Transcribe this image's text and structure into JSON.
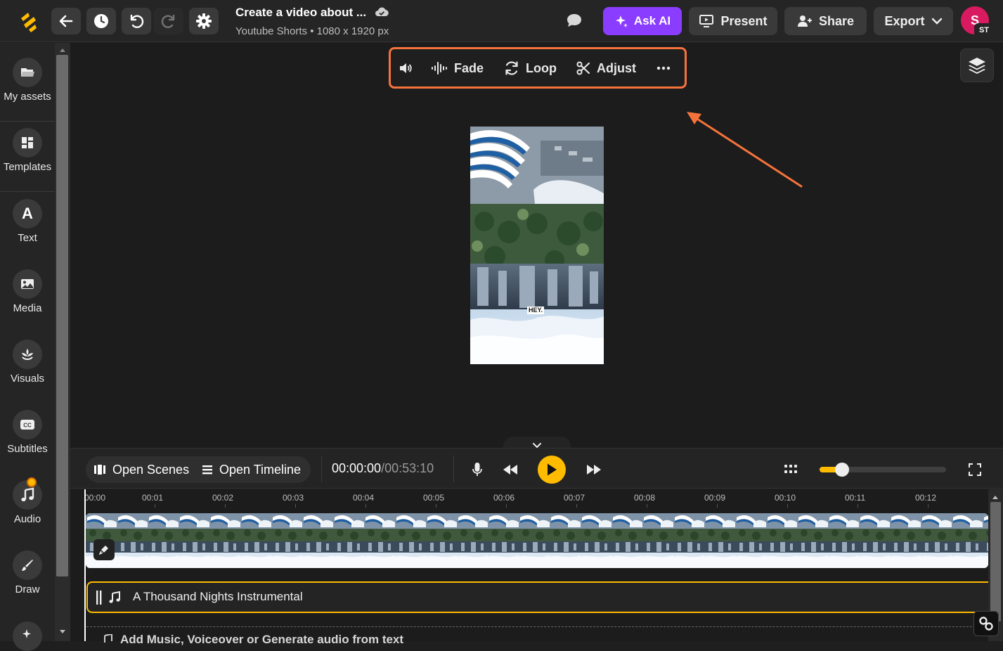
{
  "header": {
    "doc_title": "Create a video about ...",
    "doc_subtitle": "Youtube Shorts • 1080 x 1920 px",
    "ask_ai_label": "Ask AI",
    "present_label": "Present",
    "share_label": "Share",
    "export_label": "Export",
    "avatar_initial": "S",
    "avatar_badge": "ST"
  },
  "sidebar": {
    "items": [
      {
        "label": "My assets",
        "icon": "folder-icon"
      },
      {
        "label": "Templates",
        "icon": "templates-icon"
      },
      {
        "label": "Text",
        "icon": "text-icon"
      },
      {
        "label": "Media",
        "icon": "image-icon"
      },
      {
        "label": "Visuals",
        "icon": "visuals-icon"
      },
      {
        "label": "Subtitles",
        "icon": "cc-icon"
      },
      {
        "label": "Audio",
        "icon": "music-icon"
      },
      {
        "label": "Draw",
        "icon": "brush-icon"
      }
    ]
  },
  "audio_toolbar": {
    "fade_label": "Fade",
    "loop_label": "Loop",
    "adjust_label": "Adjust"
  },
  "video_preview": {
    "caption": "HEY."
  },
  "playback": {
    "open_scenes_label": "Open Scenes",
    "open_timeline_label": "Open Timeline",
    "current_time": "00:00:00",
    "total_time": "/00:53:10",
    "zoom_level": 0.18
  },
  "timeline": {
    "ruler": [
      "00:00",
      "00:01",
      "00:02",
      "00:03",
      "00:04",
      "00:05",
      "00:06",
      "00:07",
      "00:08",
      "00:09",
      "00:10",
      "00:11",
      "00:12"
    ],
    "audio_track_title": "A Thousand Nights Instrumental",
    "add_audio_label": "Add Music, Voiceover or Generate audio from text"
  },
  "colors": {
    "accent": "#ffbb00",
    "highlight": "#f5733b",
    "ask_ai": "#8b3dff",
    "avatar": "#d81b60"
  }
}
